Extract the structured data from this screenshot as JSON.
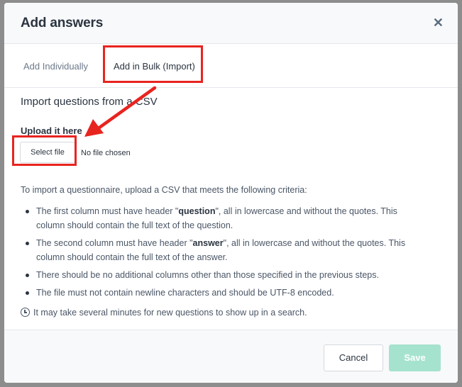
{
  "dialog": {
    "title": "Add answers"
  },
  "tabs": [
    {
      "label": "Add Individually",
      "active": false
    },
    {
      "label": "Add in Bulk (Import)",
      "active": true
    }
  ],
  "import": {
    "section_title": "Import questions from a CSV",
    "upload_label": "Upload it here",
    "file_button_label": "Select file",
    "file_status": "No file chosen",
    "intro": "To import a questionnaire, upload a CSV that meets the following criteria:",
    "criteria": [
      {
        "before": "The first column must have header \"",
        "bold": "question",
        "after": "\", all in lowercase and without the quotes. This column should contain the full text of the question."
      },
      {
        "before": "The second column must have header \"",
        "bold": "answer",
        "after": "\", all in lowercase and without the quotes. This column should contain the full text of the answer."
      },
      {
        "before": "There should be no additional columns other than those specified in the previous steps.",
        "bold": "",
        "after": ""
      },
      {
        "before": "The file must not contain newline characters and should be UTF-8 encoded.",
        "bold": "",
        "after": ""
      }
    ],
    "note": "It may take several minutes for new questions to show up in a search."
  },
  "footer": {
    "cancel_label": "Cancel",
    "save_label": "Save"
  },
  "colors": {
    "accent": "#4fc3a1",
    "save_disabled": "#a6e3cf",
    "annotation": "#e8241f"
  }
}
